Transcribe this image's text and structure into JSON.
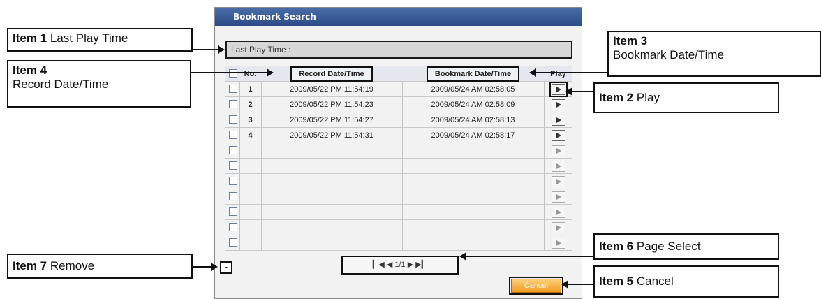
{
  "dialog": {
    "title": "Bookmark Search",
    "last_play_label": "Last Play Time :",
    "columns": {
      "no": "No.",
      "record": "Record Date/Time",
      "bookmark": "Bookmark Date/Time",
      "play": "Play"
    },
    "rows": [
      {
        "no": "1",
        "record": "2009/05/22 PM 11:54:19",
        "bookmark": "2009/05/24 AM 02:58:05"
      },
      {
        "no": "2",
        "record": "2009/05/22 PM 11:54:23",
        "bookmark": "2009/05/24 AM 02:58:09"
      },
      {
        "no": "3",
        "record": "2009/05/22 PM 11:54:27",
        "bookmark": "2009/05/24 AM 02:58:13"
      },
      {
        "no": "4",
        "record": "2009/05/22 PM 11:54:31",
        "bookmark": "2009/05/24 AM 02:58:17"
      },
      {
        "no": "",
        "record": "",
        "bookmark": ""
      },
      {
        "no": "",
        "record": "",
        "bookmark": ""
      },
      {
        "no": "",
        "record": "",
        "bookmark": ""
      },
      {
        "no": "",
        "record": "",
        "bookmark": ""
      },
      {
        "no": "",
        "record": "",
        "bookmark": ""
      },
      {
        "no": "",
        "record": "",
        "bookmark": ""
      },
      {
        "no": "",
        "record": "",
        "bookmark": ""
      }
    ],
    "pager": {
      "first_icon": "first-page-icon",
      "prev_icon": "prev-page-icon",
      "page": "1/1",
      "next_icon": "next-page-icon",
      "last_icon": "last-page-icon"
    },
    "remove_label": "-",
    "cancel_label": "Cancel"
  },
  "callouts": {
    "item1": {
      "num": "Item 1",
      "text": "Last Play Time"
    },
    "item2": {
      "num": "Item 2",
      "text": "Play"
    },
    "item3": {
      "num": "Item 3",
      "text": "Bookmark Date/Time"
    },
    "item4": {
      "num": "Item 4",
      "text": "Record Date/Time"
    },
    "item5": {
      "num": "Item 5",
      "text": "Cancel"
    },
    "item6": {
      "num": "Item 6",
      "text": "Page Select"
    },
    "item7": {
      "num": "Item 7",
      "text": "Remove"
    }
  },
  "colors": {
    "titlebar": "#2b4c88",
    "cancel": "#f09a22"
  }
}
